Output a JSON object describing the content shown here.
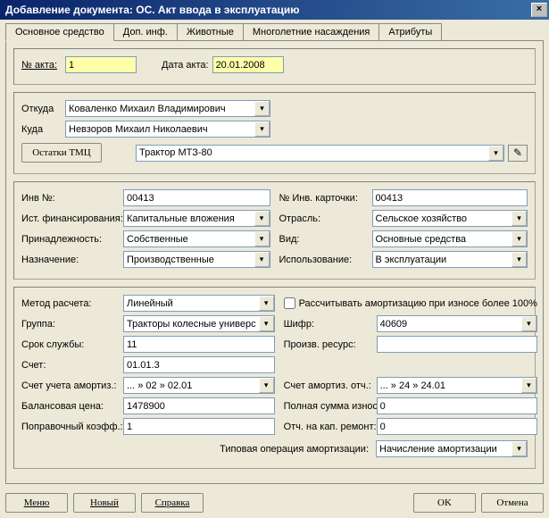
{
  "window": {
    "title": "Добавление документа: ОС. Акт ввода в эксплуатацию",
    "close": "×"
  },
  "tabs": [
    "Основное средство",
    "Доп. инф.",
    "Животные",
    "Многолетние насаждения",
    "Атрибуты"
  ],
  "actNumber": {
    "label": "№ акта:",
    "value": "1"
  },
  "actDate": {
    "label": "Дата акта:",
    "value": "20.01.2008"
  },
  "from": {
    "label": "Откуда",
    "value": "Коваленко Михаил Владимирович"
  },
  "to": {
    "label": "Куда",
    "value": "Невзоров Михаил Николаевич"
  },
  "tmcButton": "Остатки ТМЦ",
  "tmcSelect": "Трактор МТЗ-80",
  "left1": {
    "invNo": {
      "label": "Инв №:",
      "value": "00413"
    },
    "finSrc": {
      "label": "Ист. финансирования:",
      "value": "Капитальные вложения"
    },
    "belong": {
      "label": "Принадлежность:",
      "value": "Собственные"
    },
    "purpose": {
      "label": "Назначение:",
      "value": "Производственные"
    }
  },
  "right1": {
    "cardNo": {
      "label": "№ Инв. карточки:",
      "value": "00413"
    },
    "branch": {
      "label": "Отрасль:",
      "value": "Сельское хозяйство"
    },
    "kind": {
      "label": "Вид:",
      "value": "Основные средства"
    },
    "usage": {
      "label": "Использование:",
      "value": "В эксплуатации"
    }
  },
  "left2": {
    "method": {
      "label": "Метод расчета:",
      "value": "Линейный"
    },
    "group": {
      "label": "Группа:",
      "value": "Тракторы колесные универс"
    },
    "life": {
      "label": "Срок службы:",
      "value": "11"
    },
    "account": {
      "label": "Счет:",
      "value": "01.01.3"
    },
    "amortAcc": {
      "label": "Счет учета амортиз.:",
      "value": "... » 02 » 02.01"
    },
    "balance": {
      "label": "Балансовая цена:",
      "value": "1478900"
    },
    "coeff": {
      "label": "Поправочный коэфф.:",
      "value": "1"
    }
  },
  "right2": {
    "calcOver100": "Рассчитывать амортизацию при износе более 100%",
    "code": {
      "label": "Шифр:",
      "value": "40609"
    },
    "resource": {
      "label": "Произв. ресурс:",
      "value": ""
    },
    "amortAcc2": {
      "label": "Счет амортиз. отч.:",
      "value": "... » 24 » 24.01"
    },
    "wearSum": {
      "label": "Полная сумма износа:",
      "value": "0"
    },
    "capRepair": {
      "label": "Отч. на кап. ремонт:",
      "value": "0"
    },
    "typOp": {
      "label": "Типовая операция амортизации:",
      "value": "Начисление амортизации"
    }
  },
  "footer": {
    "menu": "Меню",
    "new": "Новый",
    "help": "Справка",
    "ok": "OK",
    "cancel": "Отмена"
  }
}
